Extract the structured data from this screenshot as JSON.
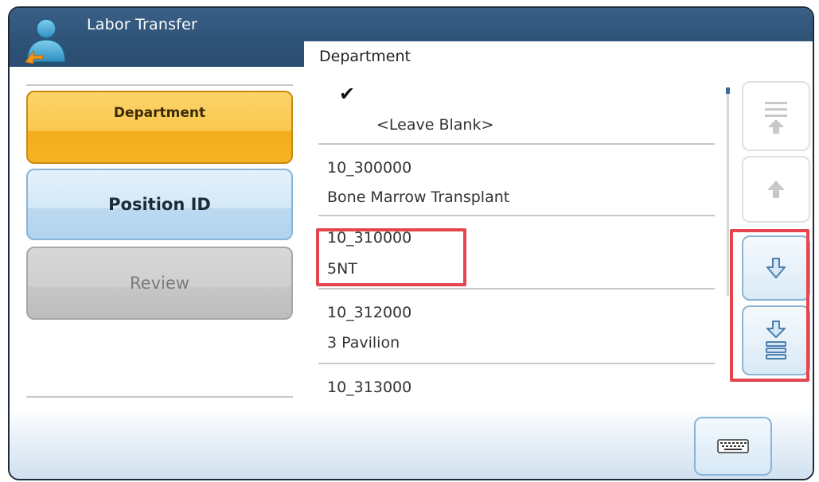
{
  "app": {
    "title": "Labor Transfer",
    "icon": "user-transfer-icon"
  },
  "sidebar": {
    "steps": [
      {
        "label": "Department",
        "state": "active"
      },
      {
        "label": "Position ID",
        "state": "available"
      },
      {
        "label": "Review",
        "state": "disabled"
      }
    ]
  },
  "content": {
    "title": "Department",
    "items": [
      {
        "check": "✔",
        "label": "<Leave Blank>",
        "selected": true
      },
      {
        "code": "10_300000",
        "name": "Bone Marrow Transplant"
      },
      {
        "code": "10_310000",
        "name": "5NT",
        "highlighted": true
      },
      {
        "code": "10_312000",
        "name": "3 Pavilion"
      },
      {
        "code": "10_313000",
        "name": ""
      }
    ]
  },
  "scroll_controls": [
    {
      "name": "scroll-to-top",
      "icon": "arrow-up-to-top-icon",
      "enabled": false
    },
    {
      "name": "scroll-up",
      "icon": "arrow-up-icon",
      "enabled": false
    },
    {
      "name": "scroll-down",
      "icon": "arrow-down-icon",
      "enabled": true,
      "highlighted": true
    },
    {
      "name": "scroll-to-bottom",
      "icon": "arrow-down-to-bottom-icon",
      "enabled": true,
      "highlighted": true
    }
  ],
  "footer": {
    "keyboard_icon": "keyboard-icon"
  },
  "colors": {
    "title_bar": "#2f5478",
    "active_step": "#f9c84e",
    "available_step": "#d3e8f8",
    "disabled_step": "#cfcfcf",
    "highlight": "#e4454e",
    "arrow_enabled": "#7aa6cf",
    "arrow_disabled": "#c8c8c8"
  }
}
